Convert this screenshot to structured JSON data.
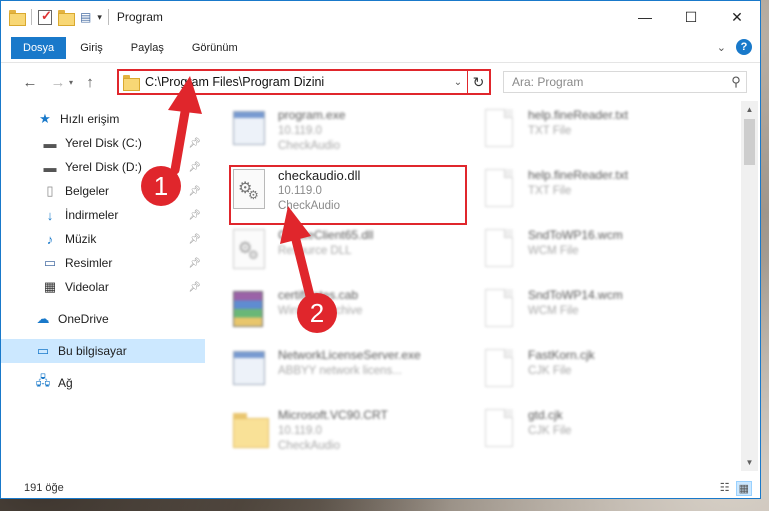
{
  "window": {
    "title": "Program",
    "controls": {
      "minimize": "—",
      "maximize": "☐",
      "close": "✕"
    }
  },
  "ribbon": {
    "tabs": [
      "Dosya",
      "Giriş",
      "Paylaş",
      "Görünüm"
    ],
    "help": "?"
  },
  "address": {
    "path": "C:\\Program Files\\Program Dizini",
    "search_placeholder": "Ara: Program"
  },
  "nav": {
    "quick_access": "Hızlı erişim",
    "items": [
      {
        "label": "Yerel Disk (C:)",
        "icon": "drive-icon"
      },
      {
        "label": "Yerel Disk (D:)",
        "icon": "drive-icon"
      },
      {
        "label": "Belgeler",
        "icon": "documents-icon"
      },
      {
        "label": "İndirmeler",
        "icon": "downloads-icon"
      },
      {
        "label": "Müzik",
        "icon": "music-icon"
      },
      {
        "label": "Resimler",
        "icon": "pictures-icon"
      },
      {
        "label": "Videolar",
        "icon": "videos-icon"
      }
    ],
    "onedrive": "OneDrive",
    "this_pc": "Bu bilgisayar",
    "network": "Ağ"
  },
  "files": {
    "left": [
      {
        "name": "program.exe",
        "line2": "10.119.0",
        "line3": "CheckAudio",
        "icon": "exe-icon"
      },
      {
        "name": "checkaudio.dll",
        "line2": "10.119.0",
        "line3": "CheckAudio",
        "icon": "dll-gear-icon"
      },
      {
        "name": "CreateClient65.dll",
        "line2": "Resource DLL",
        "line3": "",
        "icon": "dll-gear-icon"
      },
      {
        "name": "certificates.cab",
        "line2": "WinRAR archive",
        "line3": "",
        "icon": "archive-icon"
      },
      {
        "name": "NetworkLicenseServer.exe",
        "line2": "ABBYY network licens...",
        "line3": "",
        "icon": "exe-icon"
      },
      {
        "name": "Microsoft.VC90.CRT",
        "line2": "10.119.0",
        "line3": "CheckAudio",
        "icon": "folder-icon"
      }
    ],
    "right": [
      {
        "name": "help.fineReader.txt",
        "line2": "TXT File",
        "icon": "text-file-icon"
      },
      {
        "name": "help.fineReader.txt",
        "line2": "TXT File",
        "icon": "text-file-icon"
      },
      {
        "name": "SndToWP16.wcm",
        "line2": "WCM File",
        "icon": "file-icon"
      },
      {
        "name": "SndToWP14.wcm",
        "line2": "WCM File",
        "icon": "file-icon"
      },
      {
        "name": "FastKorn.cjk",
        "line2": "CJK File",
        "icon": "file-icon"
      },
      {
        "name": "gtd.cjk",
        "line2": "CJK File",
        "icon": "file-icon"
      }
    ]
  },
  "status": {
    "count": "191 öğe"
  },
  "annotations": {
    "badge1": "1",
    "badge2": "2",
    "accent": "#e0262c"
  }
}
